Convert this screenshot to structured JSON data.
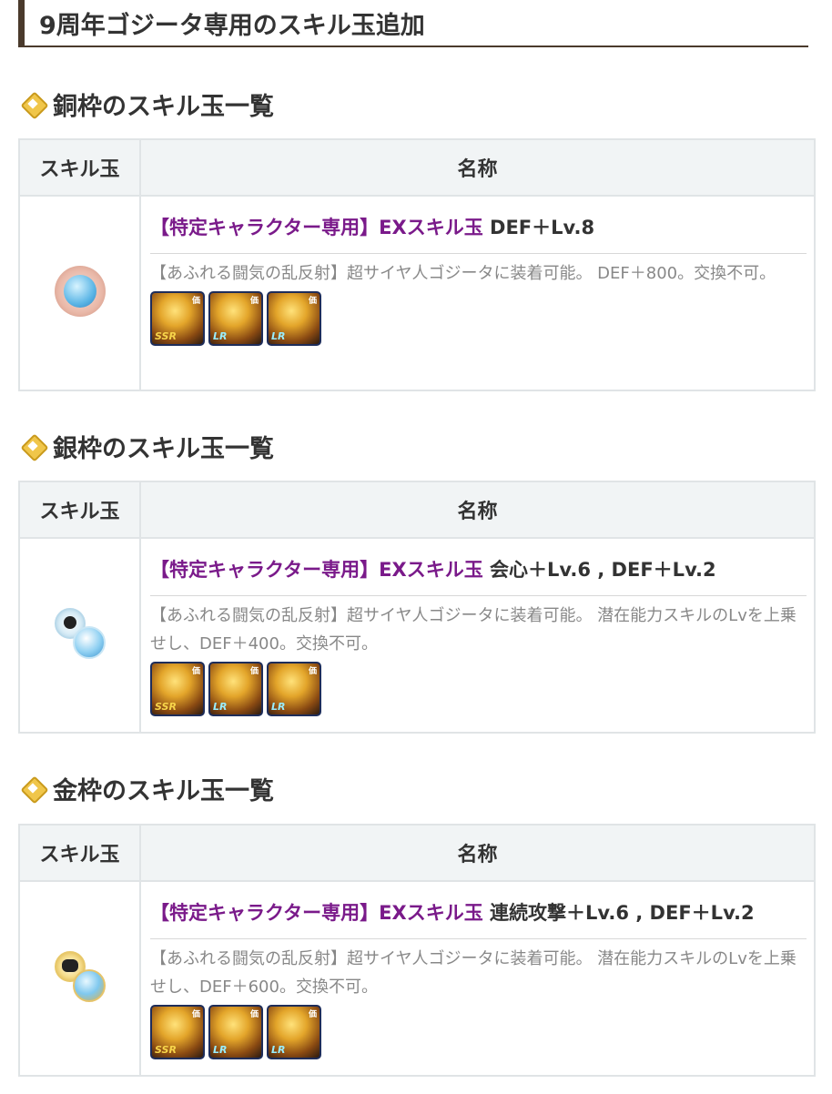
{
  "title": "9周年ゴジータ専用のスキル玉追加",
  "header": {
    "col_ball": "スキル玉",
    "col_name": "名称"
  },
  "sections": [
    {
      "heading": "銅枠のスキル玉一覧",
      "skill": {
        "prefix": "【特定キャラクター専用】EXスキル玉",
        "suffix": " DEF＋Lv.8",
        "desc": "【あふれる闘気の乱反射】超サイヤ人ゴジータに装着可能。 DEF＋800。交換不可。",
        "ball_icon": "copper-def-skill-ball",
        "characters": [
          {
            "tag": "価",
            "rank": "SSR"
          },
          {
            "tag": "価",
            "rank": "LR"
          },
          {
            "tag": "価",
            "rank": "LR"
          }
        ]
      }
    },
    {
      "heading": "銀枠のスキル玉一覧",
      "skill": {
        "prefix": "【特定キャラクター専用】EXスキル玉",
        "suffix": " 会心＋Lv.6 , DEF＋Lv.2",
        "desc": "【あふれる闘気の乱反射】超サイヤ人ゴジータに装着可能。 潜在能力スキルのLvを上乗せし、DEF＋400。交換不可。",
        "ball_icon": "silver-crit-def-skill-ball",
        "characters": [
          {
            "tag": "価",
            "rank": "SSR"
          },
          {
            "tag": "価",
            "rank": "LR"
          },
          {
            "tag": "価",
            "rank": "LR"
          }
        ]
      }
    },
    {
      "heading": "金枠のスキル玉一覧",
      "skill": {
        "prefix": "【特定キャラクター専用】EXスキル玉",
        "suffix": " 連続攻撃＋Lv.6 , DEF＋Lv.2",
        "desc": "【あふれる闘気の乱反射】超サイヤ人ゴジータに装着可能。 潜在能力スキルのLvを上乗せし、DEF＋600。交換不可。",
        "ball_icon": "gold-combo-def-skill-ball",
        "characters": [
          {
            "tag": "価",
            "rank": "SSR"
          },
          {
            "tag": "価",
            "rank": "LR"
          },
          {
            "tag": "価",
            "rank": "LR"
          }
        ]
      }
    }
  ]
}
